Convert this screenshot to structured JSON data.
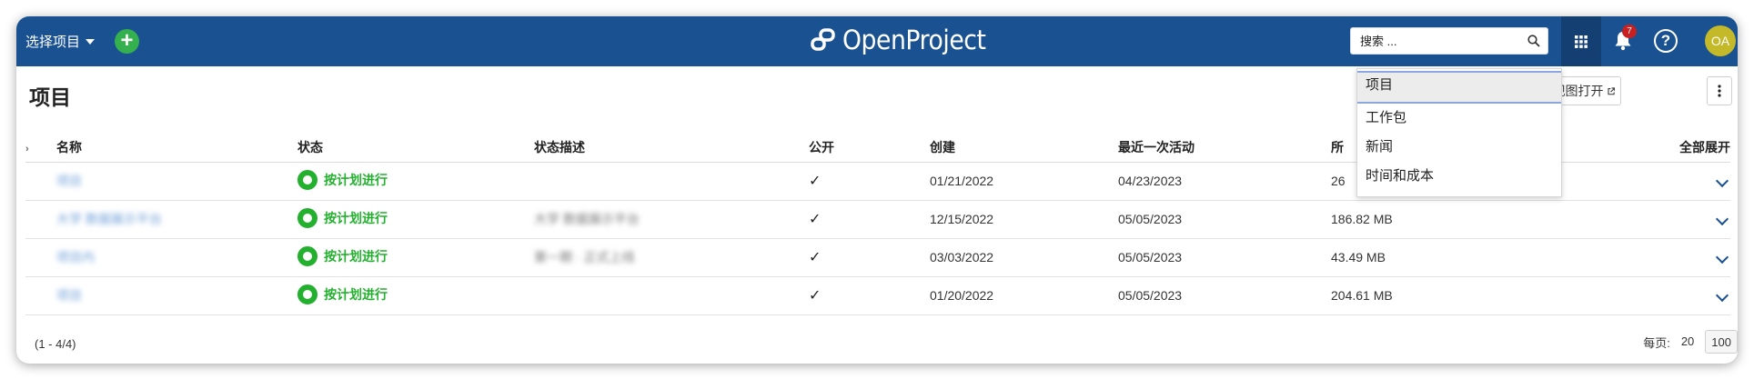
{
  "header": {
    "project_select_label": "选择项目",
    "add_label": "+",
    "logo_text": "OpenProject",
    "search_placeholder": "搜索 ...",
    "notification_count": "7",
    "help_label": "?",
    "avatar_initials": "OA"
  },
  "page": {
    "title": "项目",
    "gantt_button_label": "在甘特视图打开",
    "columns": {
      "hint": "",
      "name": "名称",
      "status": "状态",
      "status_desc": "状态描述",
      "public": "公开",
      "created": "创建",
      "last_activity": "最近一次活动",
      "required_space": "所",
      "expand_all": "全部展开"
    },
    "rows": [
      {
        "name": "项目",
        "status": "按计划进行",
        "status_desc": "",
        "public": "✓",
        "created": "01/21/2022",
        "last_activity": "04/23/2023",
        "space": "26"
      },
      {
        "name": "大学 数据展示平台",
        "status": "按计划进行",
        "status_desc": "大学 数据展示平台",
        "public": "✓",
        "created": "12/15/2022",
        "last_activity": "05/05/2023",
        "space": "186.82 MB"
      },
      {
        "name": "项目内",
        "status": "按计划进行",
        "status_desc": "第一期 · 正式上线",
        "public": "✓",
        "created": "03/03/2022",
        "last_activity": "05/05/2023",
        "space": "43.49 MB"
      },
      {
        "name": "项目",
        "status": "按计划进行",
        "status_desc": "",
        "public": "✓",
        "created": "01/20/2022",
        "last_activity": "05/05/2023",
        "space": "204.61 MB"
      }
    ],
    "pager_info": "(1 - 4/4)",
    "per_page_label": "每页:",
    "per_page_options": [
      "20",
      "100"
    ],
    "per_page_selected": "100"
  },
  "dropdown": {
    "items": [
      "项目",
      "工作包",
      "新闻",
      "时间和成本"
    ],
    "active_index": 0
  },
  "colors": {
    "header_bg": "#1a5190",
    "status_green": "#24b02f",
    "add_green": "#35b04e",
    "avatar": "#c4b928",
    "badge": "#c82020"
  }
}
